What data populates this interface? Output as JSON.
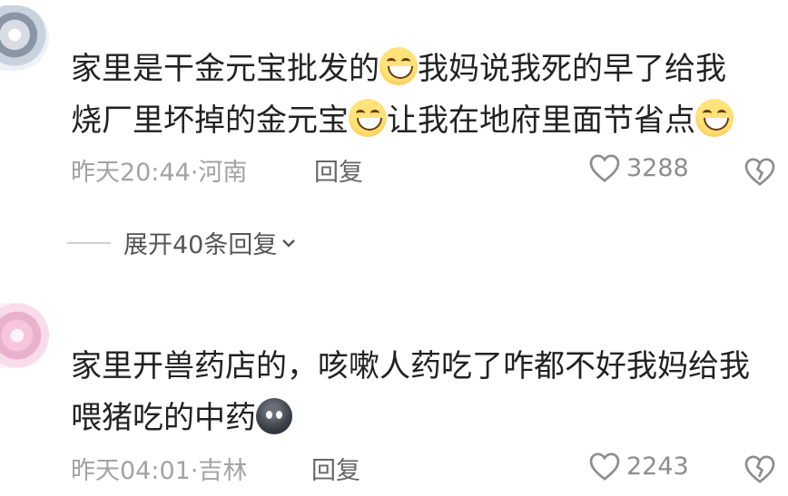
{
  "comments": [
    {
      "text_parts": [
        "家里是干金元宝批发的",
        "我妈说我死的早了给我",
        "烧厂里坏掉的金元宝",
        "让我在地府里面节省点"
      ],
      "emoji_name": "grinning-face-emoji",
      "time": "昨天20:44",
      "location": "河南",
      "reply_label": "回复",
      "likes": "3288",
      "expand_label": "展开40条回复"
    },
    {
      "text_parts": [
        "家里开兽药店的，咳嗽人药吃了咋都不好我妈给我",
        "喂猪吃的中药"
      ],
      "emoji_name": "black-face-emoji",
      "time": "昨天04:01",
      "location": "吉林",
      "reply_label": "回复",
      "likes": "2243"
    }
  ],
  "colors": {
    "text": "#222222",
    "meta": "#a3a3a3",
    "icon": "#8d8d8d"
  }
}
